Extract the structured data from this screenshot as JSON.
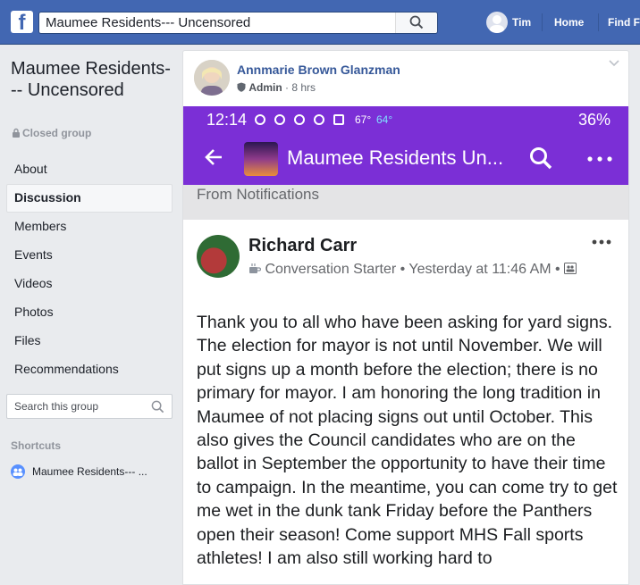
{
  "topbar": {
    "search_value": "Maumee Residents--- Uncensored",
    "user_name": "Tim",
    "home": "Home",
    "find": "Find F"
  },
  "sidebar": {
    "group_name": "Maumee Residents--- Uncensored",
    "privacy": "Closed group",
    "menu": [
      "About",
      "Discussion",
      "Members",
      "Events",
      "Videos",
      "Photos",
      "Files",
      "Recommendations"
    ],
    "active_item": "Discussion",
    "search_placeholder": "Search this group",
    "shortcuts_heading": "Shortcuts",
    "shortcut_item": "Maumee Residents--- ..."
  },
  "post": {
    "author": "Annmarie Brown Glanzman",
    "role": "Admin",
    "time": "8 hrs",
    "screenshot": {
      "status_time": "12:14",
      "temp_high": "67°",
      "temp_low": "64°",
      "battery": "36%",
      "app_title": "Maumee Residents Un...",
      "banner": "From Notifications",
      "inner_author": "Richard Carr",
      "inner_badge": "Conversation Starter",
      "inner_time": "Yesterday at 11:46 AM",
      "body": "Thank you to all who have been asking for yard signs. The election for mayor is not until November. We will put signs up  a month before the election;  there is no primary for mayor.  I am honoring the long tradition in Maumee of not placing signs out until October. This also gives the Council candidates who are on the ballot in September the opportunity to have their time to campaign. In the meantime, you can come try to get me wet in the dunk tank Friday before the Panthers open their season! Come support MHS Fall sports athletes! I am also still working hard to"
    }
  },
  "colors": {
    "facebook_blue": "#4267b2",
    "link_blue": "#365899",
    "app_purple": "#7b2fd6"
  }
}
